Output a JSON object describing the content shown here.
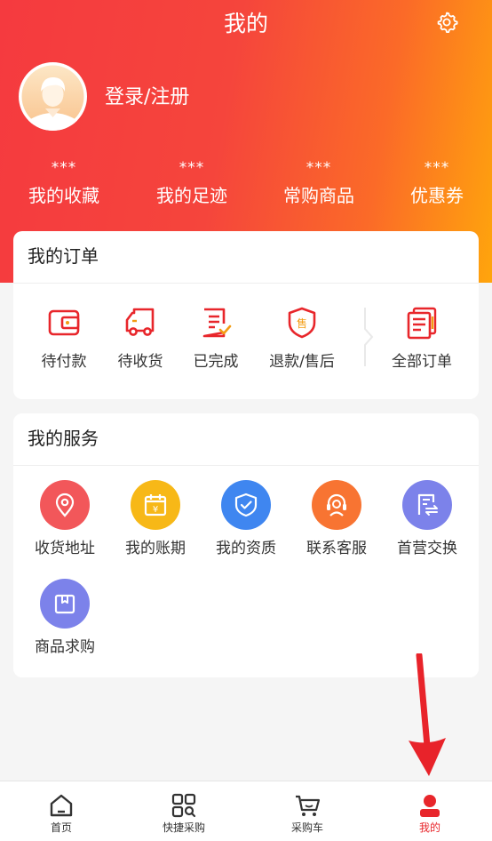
{
  "header": {
    "title": "我的"
  },
  "user": {
    "login_label": "登录/注册"
  },
  "stats": [
    {
      "value": "***",
      "label": "我的收藏"
    },
    {
      "value": "***",
      "label": "我的足迹"
    },
    {
      "value": "***",
      "label": "常购商品"
    },
    {
      "value": "***",
      "label": "优惠券"
    }
  ],
  "orders": {
    "title": "我的订单",
    "items": [
      {
        "label": "待付款",
        "icon": "wallet-icon"
      },
      {
        "label": "待收货",
        "icon": "truck-icon"
      },
      {
        "label": "已完成",
        "icon": "completed-doc-icon"
      },
      {
        "label": "退款/售后",
        "icon": "after-sale-shield-icon"
      },
      {
        "label": "全部订单",
        "icon": "all-orders-icon"
      }
    ]
  },
  "services": {
    "title": "我的服务",
    "items": [
      {
        "label": "收货地址",
        "icon": "location-pin-icon",
        "color": "#f2575a"
      },
      {
        "label": "我的账期",
        "icon": "calendar-yen-icon",
        "color": "#f7b817"
      },
      {
        "label": "我的资质",
        "icon": "shield-check-icon",
        "color": "#3f86f0"
      },
      {
        "label": "联系客服",
        "icon": "customer-service-icon",
        "color": "#f87432"
      },
      {
        "label": "首营交换",
        "icon": "exchange-icon",
        "color": "#7c82ea"
      },
      {
        "label": "商品求购",
        "icon": "box-icon",
        "color": "#7c82ea"
      }
    ]
  },
  "tabbar": {
    "items": [
      {
        "label": "首页",
        "icon": "home-icon"
      },
      {
        "label": "快捷采购",
        "icon": "quick-purchase-icon"
      },
      {
        "label": "采购车",
        "icon": "cart-icon"
      },
      {
        "label": "我的",
        "icon": "profile-icon",
        "active": true
      }
    ]
  },
  "colors": {
    "accent": "#e8262b",
    "header_gradient_start": "#f53a3f",
    "header_gradient_end": "#ffa50c"
  }
}
